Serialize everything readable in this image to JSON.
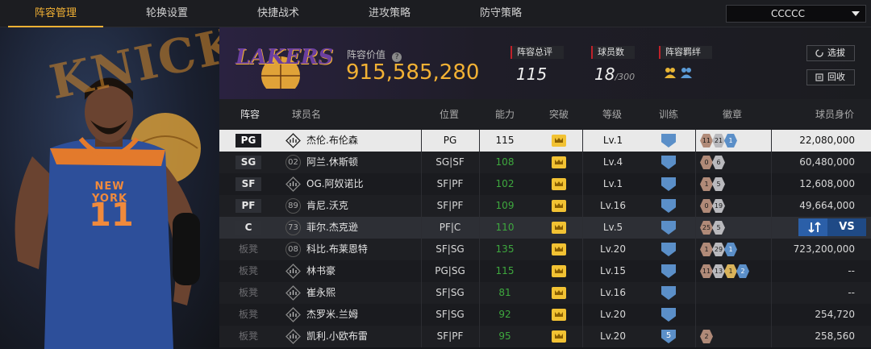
{
  "nav": {
    "tabs": [
      "阵容管理",
      "轮换设置",
      "快捷战术",
      "进攻策略",
      "防守策略"
    ],
    "active_tab": 0,
    "team_selector": "CCCCC"
  },
  "header": {
    "team_logo_text": "LAKERS",
    "lineup_value_label": "阵容价值",
    "lineup_value": "915,585,280",
    "overall_label": "阵容总评",
    "overall_value": "115",
    "player_count_label": "球员数",
    "player_count_value": "18",
    "player_count_max": "/300",
    "bonds_label": "阵容羁绊",
    "select_button": "选拔",
    "recycle_button": "回收"
  },
  "table": {
    "headers": [
      "阵容",
      "球员名",
      "位置",
      "能力",
      "突破",
      "等级",
      "训练",
      "徽章",
      "球员身价"
    ],
    "rows": [
      {
        "slot": "PG",
        "starter": true,
        "num": "",
        "name": "杰伦.布伦森",
        "position": "PG",
        "ability": "115",
        "level": "Lv.1",
        "train": "",
        "badges": [
          [
            "c",
            "11"
          ],
          [
            "s",
            "21"
          ],
          [
            "b",
            "1"
          ]
        ],
        "price": "22,080,000",
        "state": "selected"
      },
      {
        "slot": "SG",
        "starter": true,
        "num": "02",
        "name": "阿兰.休斯顿",
        "position": "SG|SF",
        "ability": "108",
        "level": "Lv.4",
        "train": "",
        "badges": [
          [
            "c",
            "0"
          ],
          [
            "s",
            "6"
          ]
        ],
        "price": "60,480,000",
        "state": ""
      },
      {
        "slot": "SF",
        "starter": true,
        "num": "",
        "name": "OG.阿奴诺比",
        "position": "SF|PF",
        "ability": "102",
        "level": "Lv.1",
        "train": "",
        "badges": [
          [
            "c",
            "1"
          ],
          [
            "s",
            "5"
          ]
        ],
        "price": "12,608,000",
        "state": ""
      },
      {
        "slot": "PF",
        "starter": true,
        "num": "89",
        "name": "肯尼.沃克",
        "position": "SF|PF",
        "ability": "109",
        "level": "Lv.16",
        "train": "",
        "badges": [
          [
            "c",
            "0"
          ],
          [
            "s",
            "19"
          ]
        ],
        "price": "49,664,000",
        "state": ""
      },
      {
        "slot": "C",
        "starter": true,
        "num": "73",
        "name": "菲尔.杰克逊",
        "position": "PF|C",
        "ability": "110",
        "level": "Lv.5",
        "train": "",
        "badges": [
          [
            "c",
            "25"
          ],
          [
            "s",
            "5"
          ]
        ],
        "price": "",
        "state": "hover"
      },
      {
        "slot": "板凳",
        "starter": false,
        "num": "08",
        "name": "科比.布莱恩特",
        "position": "SF|SG",
        "ability": "135",
        "level": "Lv.20",
        "train": "",
        "badges": [
          [
            "c",
            "1"
          ],
          [
            "s",
            "29"
          ],
          [
            "b",
            "1"
          ]
        ],
        "price": "723,200,000",
        "state": ""
      },
      {
        "slot": "板凳",
        "starter": false,
        "num": "",
        "name": "林书豪",
        "position": "PG|SG",
        "ability": "115",
        "level": "Lv.15",
        "train": "",
        "badges": [
          [
            "c",
            "11"
          ],
          [
            "s",
            "13"
          ],
          [
            "g",
            "1"
          ],
          [
            "b",
            "2"
          ]
        ],
        "price": "--",
        "state": ""
      },
      {
        "slot": "板凳",
        "starter": false,
        "num": "",
        "name": "崔永熙",
        "position": "SF|SG",
        "ability": "81",
        "level": "Lv.16",
        "train": "",
        "badges": [],
        "price": "--",
        "state": ""
      },
      {
        "slot": "板凳",
        "starter": false,
        "num": "",
        "name": "杰罗米.兰姆",
        "position": "SF|SG",
        "ability": "92",
        "level": "Lv.20",
        "train": "",
        "badges": [],
        "price": "254,720",
        "state": ""
      },
      {
        "slot": "板凳",
        "starter": false,
        "num": "",
        "name": "凯利.小欧布雷",
        "position": "SF|PF",
        "ability": "95",
        "level": "Lv.20",
        "train": "5",
        "badges": [
          [
            "c",
            "2"
          ]
        ],
        "price": "258,560",
        "state": ""
      }
    ]
  },
  "compare": {
    "label": "VS"
  },
  "hero": {
    "bg_text": "KNICKS",
    "jersey_team": "NEW YORK",
    "jersey_number": "11"
  },
  "colors": {
    "accent": "#f2b134",
    "ability": "#3ea83e",
    "knicks_blue": "#2d4f9a",
    "lakers_purple": "#6b3fa0"
  }
}
